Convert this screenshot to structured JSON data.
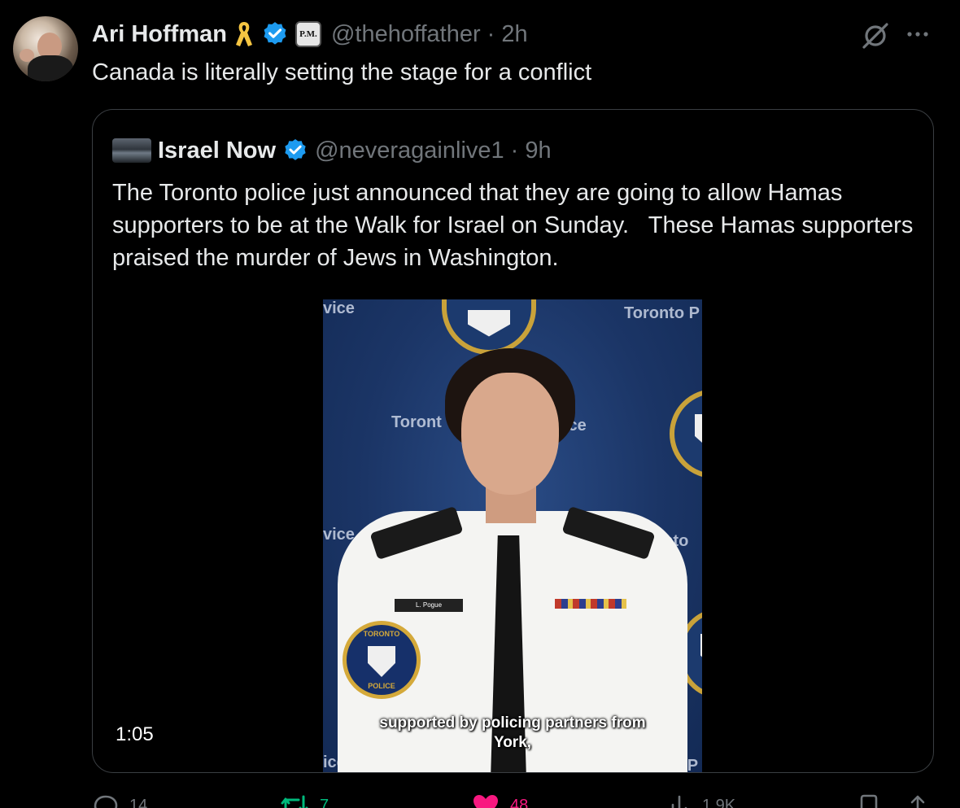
{
  "post": {
    "author_name": "Ari Hoffman",
    "affiliation_badge": "P.M.",
    "handle": "@thehoffather",
    "separator": "·",
    "time": "2h",
    "text": "Canada is literally setting the stage for a conflict",
    "icons": [
      "yellow-ribbon-icon",
      "verified-icon",
      "grok-icon",
      "more-icon"
    ]
  },
  "quote": {
    "author_name": "Israel Now",
    "handle": "@neveragainlive1",
    "separator": "·",
    "time": "9h",
    "text": "The Toronto police just announced that they are going to allow Hamas supporters to be at the Walk for Israel on Sunday.   These Hamas supporters praised the murder of Jews in Washington.",
    "video": {
      "duration": "1:05",
      "subtitle_line1": "supported by policing partners from",
      "subtitle_line2": "York,",
      "watermarks": [
        "vice",
        "Toronto P",
        "Toront",
        "ice",
        "vice",
        "oronto P",
        "ice",
        "o P"
      ],
      "nametag": "L. Pogue",
      "crest_text_top": "TORONTO",
      "crest_text_bottom": "POLICE"
    }
  },
  "actions": {
    "replies": "14",
    "reposts": "7",
    "likes": "48",
    "views": "1.9K"
  },
  "colors": {
    "background": "#000000",
    "text": "#e7e9ea",
    "muted": "#71767b",
    "verified": "#1d9bf0",
    "repost": "#00ba7c",
    "like": "#f91880",
    "ribbon": "#f5c542"
  }
}
